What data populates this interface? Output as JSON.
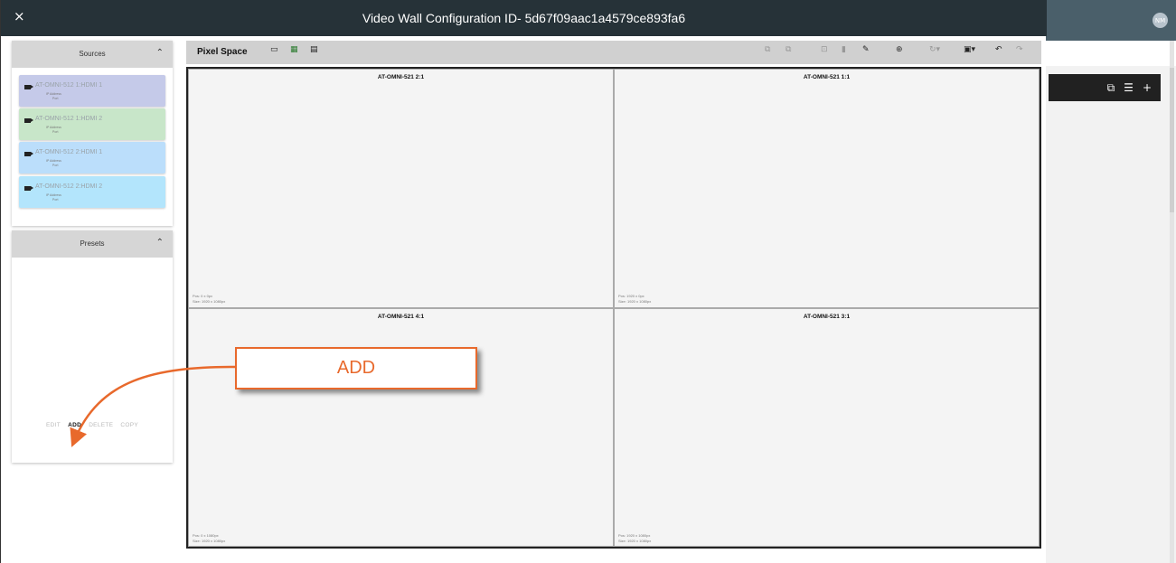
{
  "dialog": {
    "title": "Video Wall Configuration ID- 5d67f09aac1a4579ce893fa6",
    "close_glyph": "×"
  },
  "background_app": {
    "avatar_initials": "NM",
    "toolbar_icons": [
      "monitor-icon",
      "tune-icon",
      "plus-icon"
    ]
  },
  "sources": {
    "title": "Sources",
    "items": [
      {
        "name": "AT-OMNI-512 1:HDMI 1",
        "sub1": "IP Address",
        "sub2": "Port",
        "color": "#c5cae9"
      },
      {
        "name": "AT-OMNI-512 1:HDMI 2",
        "sub1": "IP Address",
        "sub2": "Port",
        "color": "#c8e6c9"
      },
      {
        "name": "AT-OMNI-512 2:HDMI 1",
        "sub1": "IP Address",
        "sub2": "Port",
        "color": "#bbdefb"
      },
      {
        "name": "AT-OMNI-512 2:HDMI 2",
        "sub1": "IP Address",
        "sub2": "Port",
        "color": "#b3e5fc"
      }
    ]
  },
  "presets": {
    "title": "Presets",
    "actions": {
      "edit": "EDIT",
      "add": "ADD",
      "delete": "DELETE",
      "copy": "COPY"
    }
  },
  "canvas": {
    "title": "Pixel Space",
    "screens": [
      {
        "name": "AT-OMNI-521 2:1",
        "pos": "Pos: 0 x 0px",
        "size": "Size: 1920 x 1080px"
      },
      {
        "name": "AT-OMNI-521 1:1",
        "pos": "Pos: 1920 x 0px",
        "size": "Size: 1920 x 1080px"
      },
      {
        "name": "AT-OMNI-521 4:1",
        "pos": "Pos: 0 x 1080px",
        "size": "Size: 1920 x 1080px"
      },
      {
        "name": "AT-OMNI-521 3:1",
        "pos": "Pos: 1920 x 1080px",
        "size": "Size: 1920 x 1080px"
      }
    ]
  },
  "callout": {
    "text": "ADD",
    "color": "#e8692c"
  },
  "colors": {
    "header": "#263238",
    "accent_orange": "#e8692c",
    "grid_icon_green": "#2e7d32"
  }
}
